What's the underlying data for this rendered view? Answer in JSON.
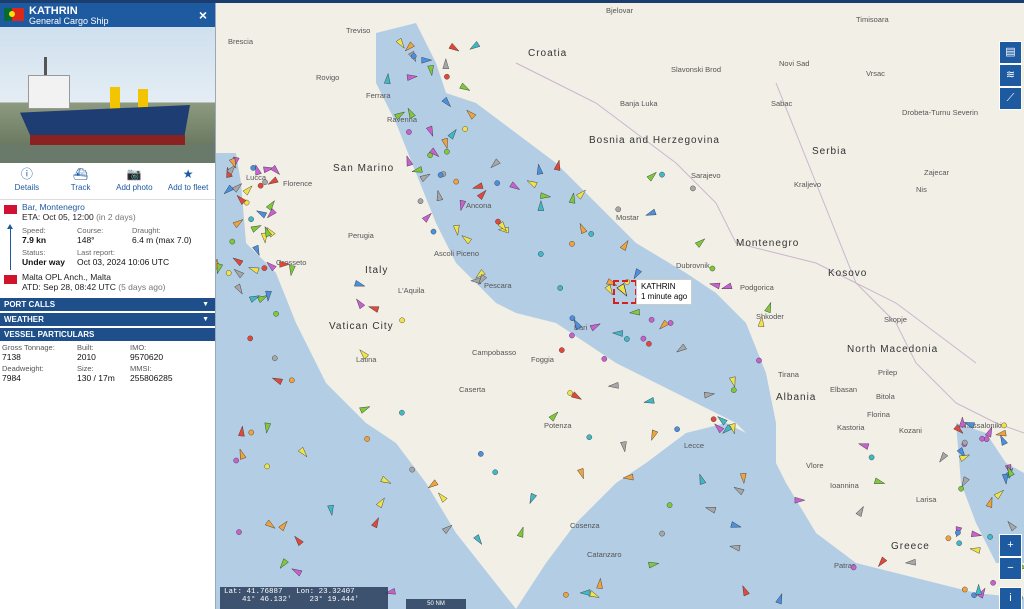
{
  "vessel": {
    "name": "KATHRIN",
    "type": "General Cargo Ship",
    "close": "×"
  },
  "actions": [
    {
      "label": "Details",
      "icon": "ⓘ"
    },
    {
      "label": "Track",
      "icon": "⛴"
    },
    {
      "label": "Add photo",
      "icon": "📷"
    },
    {
      "label": "Add to fleet",
      "icon": "★"
    }
  ],
  "destination": {
    "port": "Bar, Montenegro",
    "eta_label": "ETA:",
    "eta": "Oct 05, 12:00",
    "eta_rel": "(in 2 days)"
  },
  "stats": {
    "speed_label": "Speed:",
    "speed": "7.9 kn",
    "course_label": "Course:",
    "course": "148°",
    "draught_label": "Draught:",
    "draught": "6.4 m (max 7.0)",
    "status_label": "Status:",
    "status": "Under way",
    "report_label": "Last report:",
    "report": "Oct 03, 2024 10:06 UTC"
  },
  "departure": {
    "port": "Malta OPL Anch., Malta",
    "atd_label": "ATD:",
    "atd": "Sep 28, 08:42 UTC",
    "atd_rel": "(5 days ago)"
  },
  "sections": {
    "port_calls": "PORT CALLS",
    "weather": "WEATHER",
    "particulars": "VESSEL PARTICULARS"
  },
  "particulars": {
    "gt_label": "Gross Tonnage:",
    "gt": "7138",
    "built_label": "Built:",
    "built": "2010",
    "imo_label": "IMO:",
    "imo": "9570620",
    "dwt_label": "Deadweight:",
    "dwt": "7984",
    "size_label": "Size:",
    "size": "130 / 17m",
    "mmsi_label": "MMSI:",
    "mmsi": "255806285"
  },
  "map": {
    "countries": [
      "Croatia",
      "Bosnia and Herzegovina",
      "Serbia",
      "San Marino",
      "Italy",
      "Montenegro",
      "Kosovo",
      "Vatican City",
      "Albania",
      "North Macedonia",
      "Greece"
    ],
    "cities": [
      "Treviso",
      "Brescia",
      "Bjelovar",
      "Timisoara",
      "Rovigo",
      "Slavonski Brod",
      "Novi Sad",
      "Vrsac",
      "Ferrara",
      "Banja Luka",
      "Sabac",
      "Dubrovnik",
      "Sarajevo",
      "Drobeta-Turnu Severin",
      "Ravenna",
      "Mostar",
      "Kraljevo",
      "Nis",
      "Zajecar",
      "Lucca",
      "Florence",
      "Perugia",
      "Ancona",
      "Ascoli Piceno",
      "Pescara",
      "L'Aquila",
      "Grosseto",
      "Campobasso",
      "Foggia",
      "Bari",
      "Latina",
      "Caserta",
      "Potenza",
      "Lecce",
      "Cosenza",
      "Catanzaro",
      "Podgorica",
      "Shkoder",
      "Tirana",
      "Elbasan",
      "Vlore",
      "Skopje",
      "Prilep",
      "Bitola",
      "Florina",
      "Kozani",
      "Kastoria",
      "Thessaloniki",
      "Ioannina",
      "Larisa",
      "Patras"
    ],
    "tooltip_name": "KATHRIN",
    "tooltip_time": "1 minute ago",
    "lat_label": "Lat:",
    "lat": "41.76887",
    "lat_dms": "41° 46.132'",
    "lon_label": "Lon:",
    "lon": "23.32407",
    "lon_dms": "23° 19.444'",
    "scale": "50 NM",
    "zoom_in": "+",
    "zoom_out": "−",
    "info": "i"
  }
}
